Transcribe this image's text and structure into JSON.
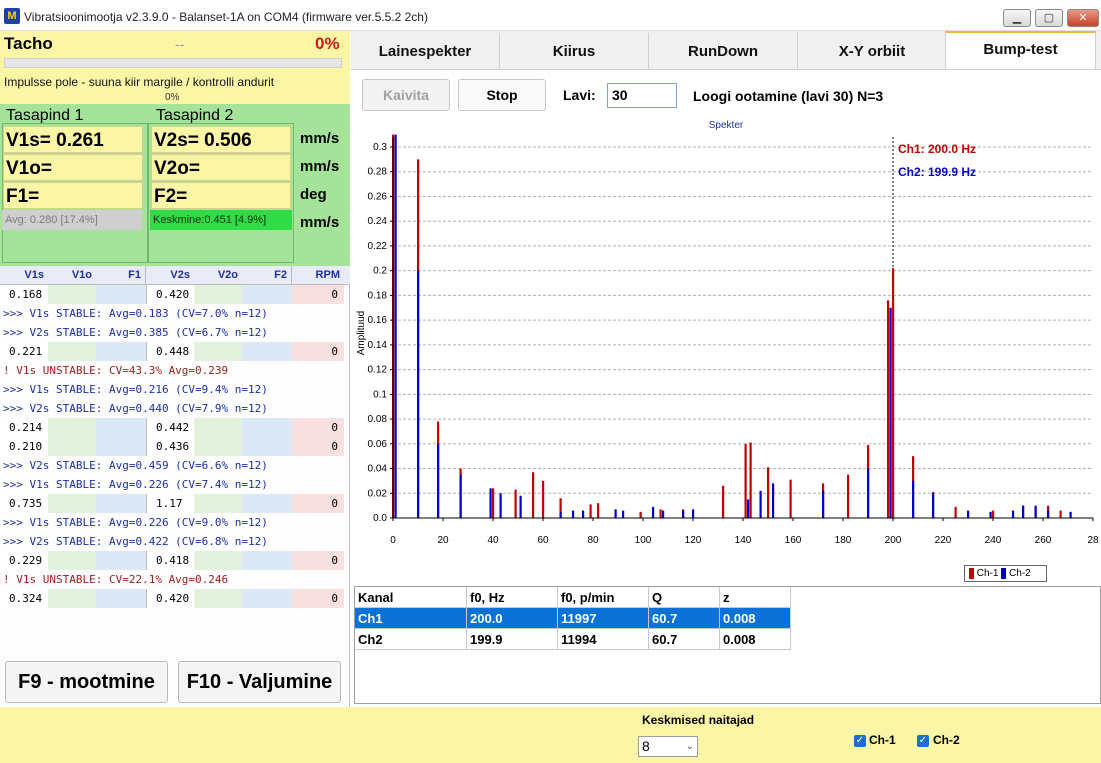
{
  "window": {
    "title": "Vibratsioonimootja v2.3.9.0 - Balanset-1A on COM4 (firmware ver.5.5.2 2ch)",
    "icon_text": "M",
    "minimize_icon": "minimize-icon",
    "maximize_icon": "maximize-icon",
    "close_icon": "close-icon"
  },
  "tacho": {
    "label": "Tacho",
    "dash": "--",
    "percent": "0%",
    "progress_fraction": 0.0,
    "impulse_text": "Impulsse pole - suuna kiir margile / kontrolli andurit",
    "impulse_percent": "0%"
  },
  "planes": {
    "plane1_title": "Tasapind 1",
    "plane2_title": "Tasapind 2",
    "v1s": "V1s= 0.261",
    "v1o": "V1o=",
    "f1": "F1=",
    "v2s": "V2s= 0.506",
    "v2o": "V2o=",
    "f2": "F2=",
    "units": [
      "mm/s",
      "mm/s",
      "deg",
      "mm/s"
    ],
    "avg1": "Avg: 0.280 [17.4%]",
    "avg2": "Keskmine:0.451 [4.9%]"
  },
  "log_headers": [
    "V1s",
    "V1o",
    "F1",
    "V2s",
    "V2o",
    "F2",
    "RPM"
  ],
  "log_rows": [
    {
      "type": "data",
      "v1s": "0.168",
      "v2s": "0.420",
      "rpm": "0"
    },
    {
      "type": "msg",
      "text": ">>> V1s STABLE: Avg=0.183 (CV=7.0% n=12)"
    },
    {
      "type": "msg",
      "text": ">>> V2s STABLE: Avg=0.385 (CV=6.7% n=12)"
    },
    {
      "type": "data",
      "v1s": "0.221",
      "v2s": "0.448",
      "rpm": "0"
    },
    {
      "type": "warn",
      "text": "! V1s UNSTABLE: CV=43.3% Avg=0.239"
    },
    {
      "type": "msg",
      "text": ">>> V1s STABLE: Avg=0.216 (CV=9.4% n=12)"
    },
    {
      "type": "msg",
      "text": ">>> V2s STABLE: Avg=0.440 (CV=7.9% n=12)"
    },
    {
      "type": "data",
      "v1s": "0.214",
      "v2s": "0.442",
      "rpm": "0"
    },
    {
      "type": "data",
      "v1s": "0.210",
      "v2s": "0.436",
      "rpm": "0"
    },
    {
      "type": "msg",
      "text": ">>> V2s STABLE: Avg=0.459 (CV=6.6% n=12)"
    },
    {
      "type": "msg",
      "text": ">>> V1s STABLE: Avg=0.226 (CV=7.4% n=12)"
    },
    {
      "type": "data",
      "v1s": "0.735",
      "v2s": "1.17",
      "rpm": "0"
    },
    {
      "type": "msg",
      "text": ">>> V1s STABLE: Avg=0.226 (CV=9.0% n=12)"
    },
    {
      "type": "msg",
      "text": ">>> V2s STABLE: Avg=0.422 (CV=6.8% n=12)"
    },
    {
      "type": "data",
      "v1s": "0.229",
      "v2s": "0.418",
      "rpm": "0"
    },
    {
      "type": "warn",
      "text": "! V1s UNSTABLE: CV=22.1% Avg=0.246"
    },
    {
      "type": "data",
      "v1s": "0.324",
      "v2s": "0.420",
      "rpm": "0"
    }
  ],
  "buttons": {
    "f9": "F9 - mootmine",
    "f10": "F10 - Valjumine",
    "kaivita": "Kaivita",
    "stop": "Stop"
  },
  "tabs": [
    "Lainespekter",
    "Kiirus",
    "RunDown",
    "X-Y orbiit",
    "Bump-test"
  ],
  "active_tab": "Bump-test",
  "toolbar": {
    "lavi_label": "Lavi:",
    "lavi_value": "30",
    "status": "Loogi ootamine (lavi 30)  N=3"
  },
  "colors": {
    "ch1": "#c00000",
    "ch2": "#0000c8",
    "selected_row": "#0a72d6",
    "tacho_bg": "#fbf5a6",
    "plane_bg": "#a5e39a"
  },
  "chart_data": {
    "type": "bar",
    "title": "Spekter",
    "ylabel": "Amplituud",
    "xlabel": "",
    "xlim": [
      0,
      280
    ],
    "ylim": [
      0,
      0.3
    ],
    "x_ticks": [
      "0",
      "20",
      "40",
      "60",
      "80",
      "100",
      "120",
      "140",
      "160",
      "180",
      "200",
      "220",
      "240",
      "260",
      "28"
    ],
    "y_ticks": [
      "0.0",
      "0.02",
      "0.04",
      "0.06",
      "0.08",
      "0.1",
      "0.12",
      "0.14",
      "0.16",
      "0.18",
      "0.2",
      "0.22",
      "0.24",
      "0.26",
      "0.28",
      "0.3"
    ],
    "grid": true,
    "cursor_x": 200,
    "annotations": [
      "Ch1: 200.0 Hz",
      "Ch2: 199.9 Hz"
    ],
    "legend_position": "bottom-right",
    "series": [
      {
        "name": "Ch-1",
        "color": "#c00000",
        "points": [
          [
            0,
            0.31
          ],
          [
            10,
            0.29
          ],
          [
            18,
            0.078
          ],
          [
            27,
            0.04
          ],
          [
            40,
            0.024
          ],
          [
            49,
            0.023
          ],
          [
            56,
            0.037
          ],
          [
            60,
            0.03
          ],
          [
            67,
            0.016
          ],
          [
            79,
            0.011
          ],
          [
            82,
            0.012
          ],
          [
            99,
            0.005
          ],
          [
            107,
            0.007
          ],
          [
            116,
            0.007
          ],
          [
            132,
            0.026
          ],
          [
            141,
            0.06
          ],
          [
            143,
            0.061
          ],
          [
            150,
            0.041
          ],
          [
            159,
            0.031
          ],
          [
            172,
            0.028
          ],
          [
            182,
            0.035
          ],
          [
            190,
            0.059
          ],
          [
            198,
            0.176
          ],
          [
            200,
            0.202
          ],
          [
            208,
            0.05
          ],
          [
            216,
            0.021
          ],
          [
            225,
            0.009
          ],
          [
            240,
            0.006
          ],
          [
            252,
            0.01
          ],
          [
            257,
            0.008
          ],
          [
            262,
            0.01
          ],
          [
            267,
            0.006
          ]
        ]
      },
      {
        "name": "Ch-2",
        "color": "#0000c8",
        "points": [
          [
            1,
            0.31
          ],
          [
            10,
            0.2
          ],
          [
            18,
            0.06
          ],
          [
            27,
            0.035
          ],
          [
            39,
            0.024
          ],
          [
            43,
            0.02
          ],
          [
            51,
            0.018
          ],
          [
            67,
            0.005
          ],
          [
            72,
            0.006
          ],
          [
            76,
            0.006
          ],
          [
            89,
            0.007
          ],
          [
            92,
            0.006
          ],
          [
            104,
            0.009
          ],
          [
            108,
            0.006
          ],
          [
            116,
            0.006
          ],
          [
            120,
            0.007
          ],
          [
            142,
            0.015
          ],
          [
            147,
            0.022
          ],
          [
            152,
            0.028
          ],
          [
            172,
            0.022
          ],
          [
            190,
            0.04
          ],
          [
            199,
            0.17
          ],
          [
            208,
            0.03
          ],
          [
            216,
            0.02
          ],
          [
            230,
            0.006
          ],
          [
            239,
            0.005
          ],
          [
            248,
            0.006
          ],
          [
            252,
            0.01
          ],
          [
            257,
            0.01
          ],
          [
            262,
            0.006
          ],
          [
            271,
            0.005
          ]
        ]
      }
    ]
  },
  "results_table": {
    "headers": [
      "Kanal",
      "f0, Hz",
      "f0, p/min",
      "Q",
      "z"
    ],
    "rows": [
      [
        "Ch1",
        "200.0",
        "11997",
        "60.7",
        "0.008"
      ],
      [
        "Ch2",
        "199.9",
        "11994",
        "60.7",
        "0.008"
      ]
    ],
    "selected_row": 0
  },
  "bottom": {
    "avg_label": "Keskmised naitajad",
    "avg_value": "8",
    "ch1_label": "Ch-1",
    "ch2_label": "Ch-2",
    "ch1_checked": true,
    "ch2_checked": true
  }
}
